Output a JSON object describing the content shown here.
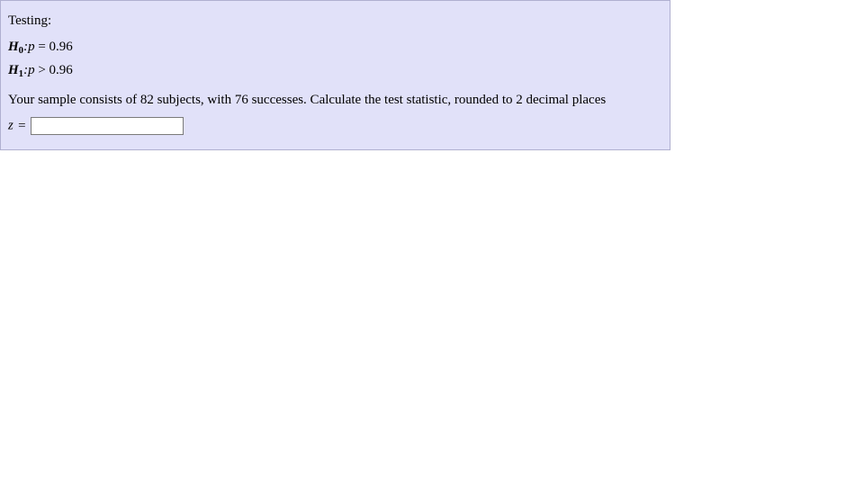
{
  "question": {
    "testing_label": "Testing:",
    "h0": {
      "label": "H",
      "sub": "0",
      "colon": ":",
      "var": "p",
      "rel": "=",
      "value": "0.96"
    },
    "h1": {
      "label": "H",
      "sub": "1",
      "colon": ":",
      "var": "p",
      "rel": ">",
      "value": "0.96"
    },
    "sample_text_1": "Your sample consists of ",
    "sample_n": "82",
    "sample_text_2": " subjects, with ",
    "sample_successes": "76",
    "sample_text_3": " successes. Calculate the test statistic, rounded to 2 decimal places",
    "answer": {
      "var": "z",
      "eq": "=",
      "value": ""
    }
  }
}
